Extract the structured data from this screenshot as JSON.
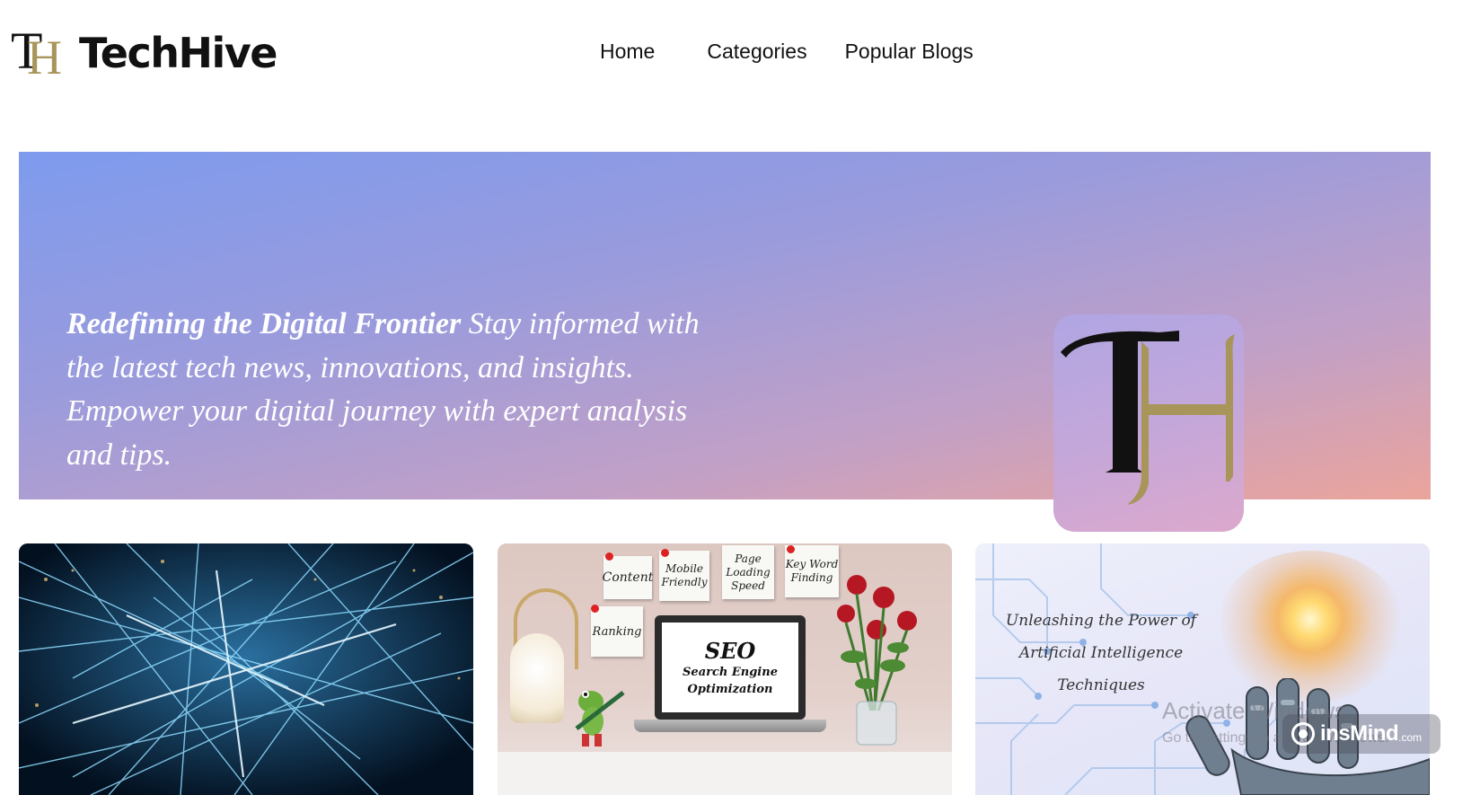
{
  "header": {
    "brand": "TechHive",
    "logo_monogram": "TH",
    "nav": [
      {
        "label": "Home"
      },
      {
        "label": "Categories"
      },
      {
        "label": "Popular Blogs"
      }
    ]
  },
  "hero": {
    "headline": "Redefining the Digital Frontier",
    "body": "Stay informed with the latest tech news, innovations, and insights. Empower your digital journey with expert analysis and tips.",
    "logo_monogram": "TH",
    "gradient": [
      "#7e9bee",
      "#c2a0c6",
      "#eba49c"
    ]
  },
  "cards": [
    {
      "image": "network-lines-image"
    },
    {
      "image": "seo-desk-image",
      "notes": [
        "Content",
        "Mobile Friendly",
        "Page Loading Speed",
        "Key Word Finding",
        "Ranking"
      ],
      "screen_title": "SEO",
      "screen_subtitle": "Search Engine Optimization"
    },
    {
      "image": "ai-robot-hand-image",
      "caption_line1": "Unleashing the Power of",
      "caption_line2": "Artificial Intelligence Techniques"
    }
  ],
  "watermarks": {
    "activate_title": "Activate Windows",
    "activate_sub": "Go to Settings to activate Windows.",
    "insmind_brand": "insMind",
    "insmind_domain": ".com"
  },
  "colors": {
    "text_dark": "#111111",
    "logo_gold": "#a8955a",
    "page_bg": "#ffffff"
  }
}
